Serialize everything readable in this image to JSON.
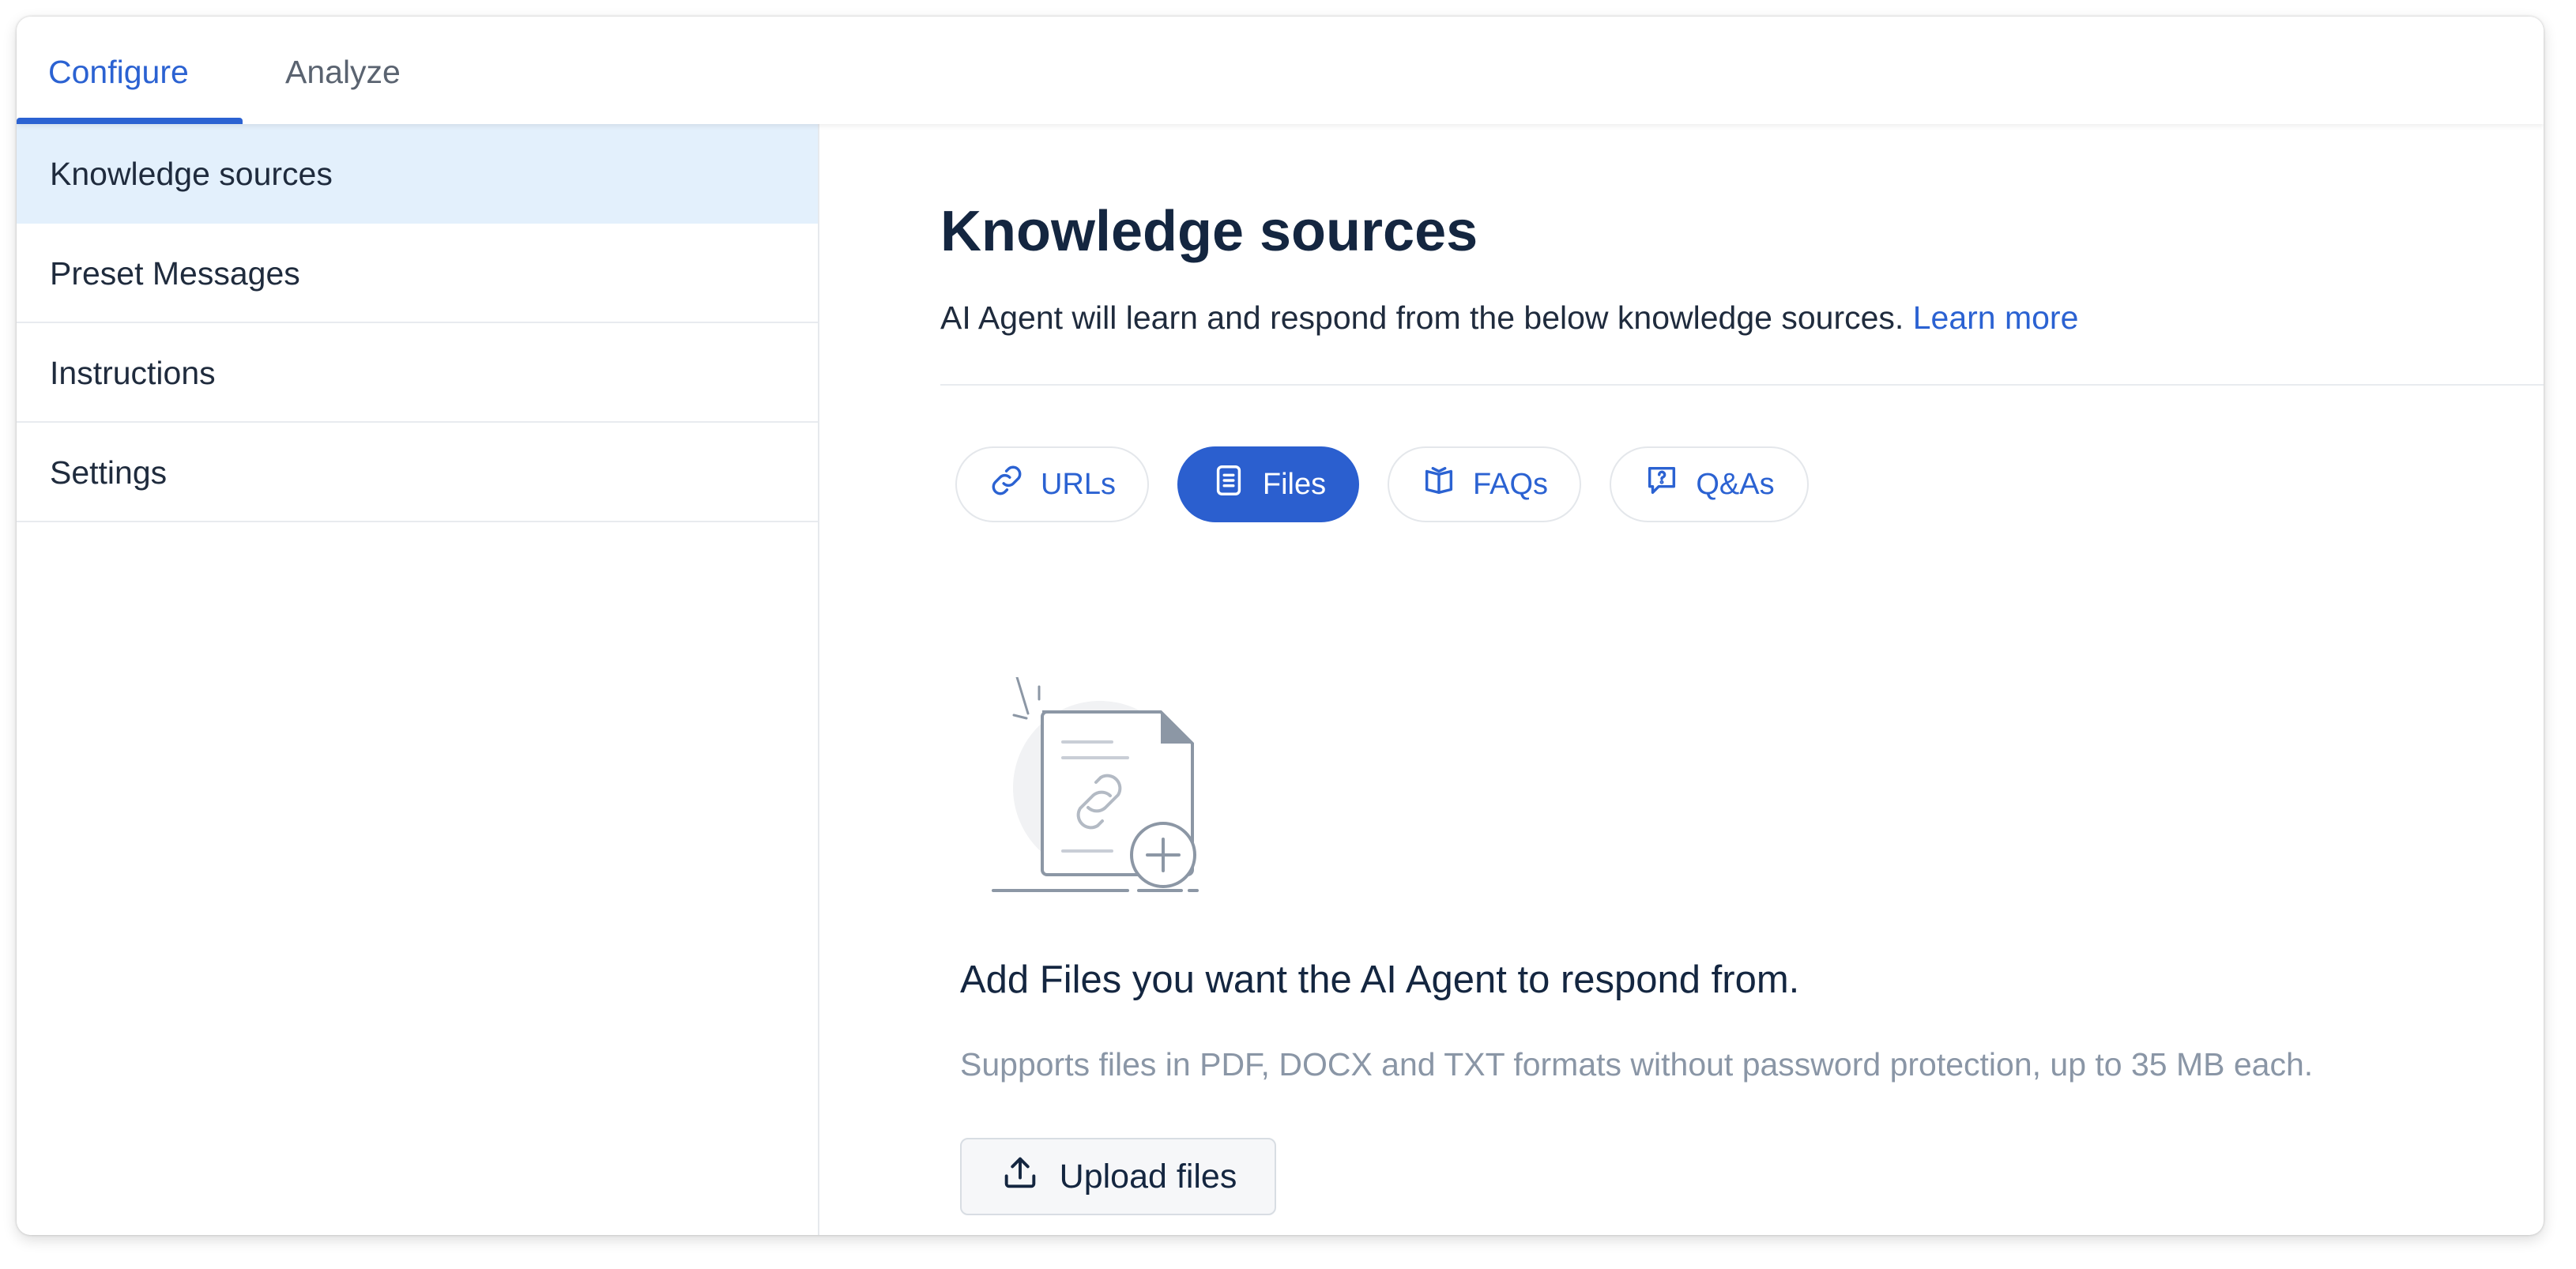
{
  "tabs": [
    {
      "label": "Configure",
      "active": true
    },
    {
      "label": "Analyze",
      "active": false
    }
  ],
  "sidebar": {
    "items": [
      {
        "label": "Knowledge sources",
        "active": true
      },
      {
        "label": "Preset Messages",
        "active": false
      },
      {
        "label": "Instructions",
        "active": false
      },
      {
        "label": "Settings",
        "active": false
      }
    ]
  },
  "main": {
    "title": "Knowledge sources",
    "subtitle": "AI Agent will learn and respond from the below knowledge sources.",
    "learn_more": "Learn more",
    "source_tabs": [
      {
        "label": "URLs",
        "icon": "link-icon",
        "active": false
      },
      {
        "label": "Files",
        "icon": "document-icon",
        "active": true
      },
      {
        "label": "FAQs",
        "icon": "book-icon",
        "active": false
      },
      {
        "label": "Q&As",
        "icon": "question-bubble-icon",
        "active": false
      }
    ],
    "empty_state": {
      "title": "Add Files you want the AI Agent to respond from.",
      "description": "Supports files in PDF, DOCX and TXT formats without password protection, up to 35 MB each.",
      "button_label": "Upload files",
      "button_icon": "upload-icon"
    }
  },
  "colors": {
    "accent": "#2b62d2",
    "active_pill": "#2b5fcf",
    "active_sidebar": "#e3f0fc",
    "heading": "#142640",
    "muted": "#8a96a6"
  }
}
